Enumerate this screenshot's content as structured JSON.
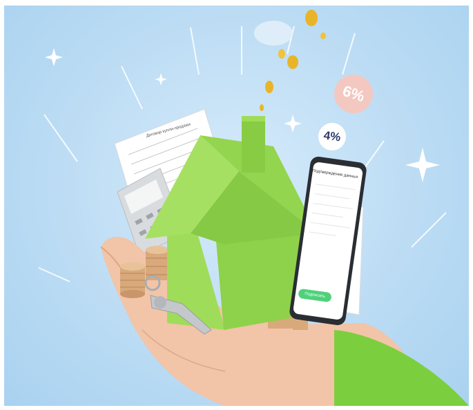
{
  "image": {
    "badges": [
      {
        "label": "6%",
        "color": "#f3c8c0"
      },
      {
        "label": "4%",
        "color": "#ffffff"
      }
    ],
    "phone": {
      "title": "Подтверждение данных",
      "button_label": "Подписать"
    },
    "document": {
      "title": "Договор купли-продажи"
    },
    "colors": {
      "house": "#8ed14a",
      "background": "#bcdcf4",
      "sleeve": "#7bcf3e"
    }
  }
}
